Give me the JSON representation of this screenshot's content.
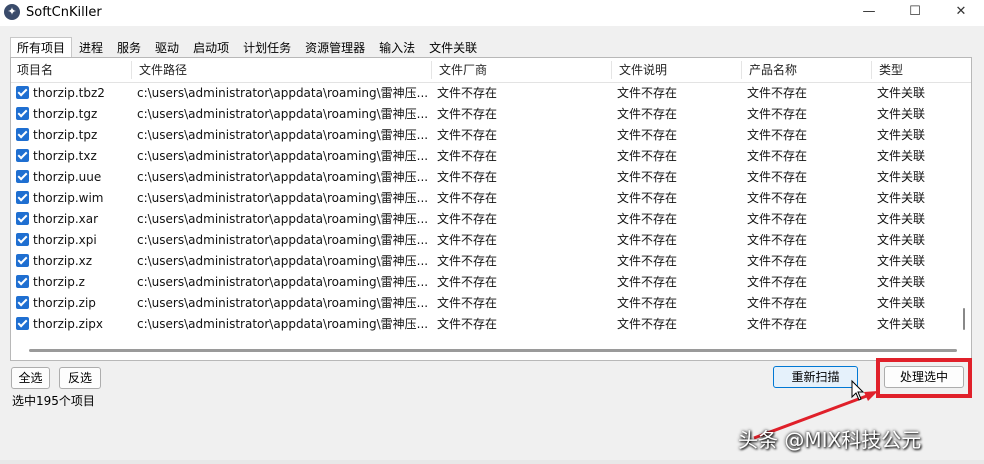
{
  "window": {
    "title": "SoftCnKiller",
    "icon": "app-logo-icon",
    "controls": {
      "minimize": "—",
      "maximize": "☐",
      "close": "✕"
    }
  },
  "tabs": [
    {
      "label": "所有项目",
      "active": true
    },
    {
      "label": "进程"
    },
    {
      "label": "服务"
    },
    {
      "label": "驱动"
    },
    {
      "label": "启动项"
    },
    {
      "label": "计划任务"
    },
    {
      "label": "资源管理器"
    },
    {
      "label": "输入法"
    },
    {
      "label": "文件关联"
    }
  ],
  "table": {
    "columns": [
      "项目名",
      "文件路径",
      "文件厂商",
      "文件说明",
      "产品名称",
      "类型"
    ],
    "rows": [
      {
        "checked": true,
        "name": "thorzip.tbz2",
        "path": "c:\\users\\administrator\\appdata\\roaming\\雷神压...",
        "vendor": "文件不存在",
        "desc": "文件不存在",
        "product": "文件不存在",
        "type": "文件关联"
      },
      {
        "checked": true,
        "name": "thorzip.tgz",
        "path": "c:\\users\\administrator\\appdata\\roaming\\雷神压...",
        "vendor": "文件不存在",
        "desc": "文件不存在",
        "product": "文件不存在",
        "type": "文件关联"
      },
      {
        "checked": true,
        "name": "thorzip.tpz",
        "path": "c:\\users\\administrator\\appdata\\roaming\\雷神压...",
        "vendor": "文件不存在",
        "desc": "文件不存在",
        "product": "文件不存在",
        "type": "文件关联"
      },
      {
        "checked": true,
        "name": "thorzip.txz",
        "path": "c:\\users\\administrator\\appdata\\roaming\\雷神压...",
        "vendor": "文件不存在",
        "desc": "文件不存在",
        "product": "文件不存在",
        "type": "文件关联"
      },
      {
        "checked": true,
        "name": "thorzip.uue",
        "path": "c:\\users\\administrator\\appdata\\roaming\\雷神压...",
        "vendor": "文件不存在",
        "desc": "文件不存在",
        "product": "文件不存在",
        "type": "文件关联"
      },
      {
        "checked": true,
        "name": "thorzip.wim",
        "path": "c:\\users\\administrator\\appdata\\roaming\\雷神压...",
        "vendor": "文件不存在",
        "desc": "文件不存在",
        "product": "文件不存在",
        "type": "文件关联"
      },
      {
        "checked": true,
        "name": "thorzip.xar",
        "path": "c:\\users\\administrator\\appdata\\roaming\\雷神压...",
        "vendor": "文件不存在",
        "desc": "文件不存在",
        "product": "文件不存在",
        "type": "文件关联"
      },
      {
        "checked": true,
        "name": "thorzip.xpi",
        "path": "c:\\users\\administrator\\appdata\\roaming\\雷神压...",
        "vendor": "文件不存在",
        "desc": "文件不存在",
        "product": "文件不存在",
        "type": "文件关联"
      },
      {
        "checked": true,
        "name": "thorzip.xz",
        "path": "c:\\users\\administrator\\appdata\\roaming\\雷神压...",
        "vendor": "文件不存在",
        "desc": "文件不存在",
        "product": "文件不存在",
        "type": "文件关联"
      },
      {
        "checked": true,
        "name": "thorzip.z",
        "path": "c:\\users\\administrator\\appdata\\roaming\\雷神压...",
        "vendor": "文件不存在",
        "desc": "文件不存在",
        "product": "文件不存在",
        "type": "文件关联"
      },
      {
        "checked": true,
        "name": "thorzip.zip",
        "path": "c:\\users\\administrator\\appdata\\roaming\\雷神压...",
        "vendor": "文件不存在",
        "desc": "文件不存在",
        "product": "文件不存在",
        "type": "文件关联"
      },
      {
        "checked": true,
        "name": "thorzip.zipx",
        "path": "c:\\users\\administrator\\appdata\\roaming\\雷神压...",
        "vendor": "文件不存在",
        "desc": "文件不存在",
        "product": "文件不存在",
        "type": "文件关联"
      }
    ]
  },
  "buttons": {
    "select_all": "全选",
    "invert": "反选",
    "rescan": "重新扫描",
    "process_selected": "处理选中"
  },
  "status": "选中195个项目",
  "annotation": {
    "highlight_color": "#e0202a"
  },
  "watermark": "头条 @MIX科技公元"
}
